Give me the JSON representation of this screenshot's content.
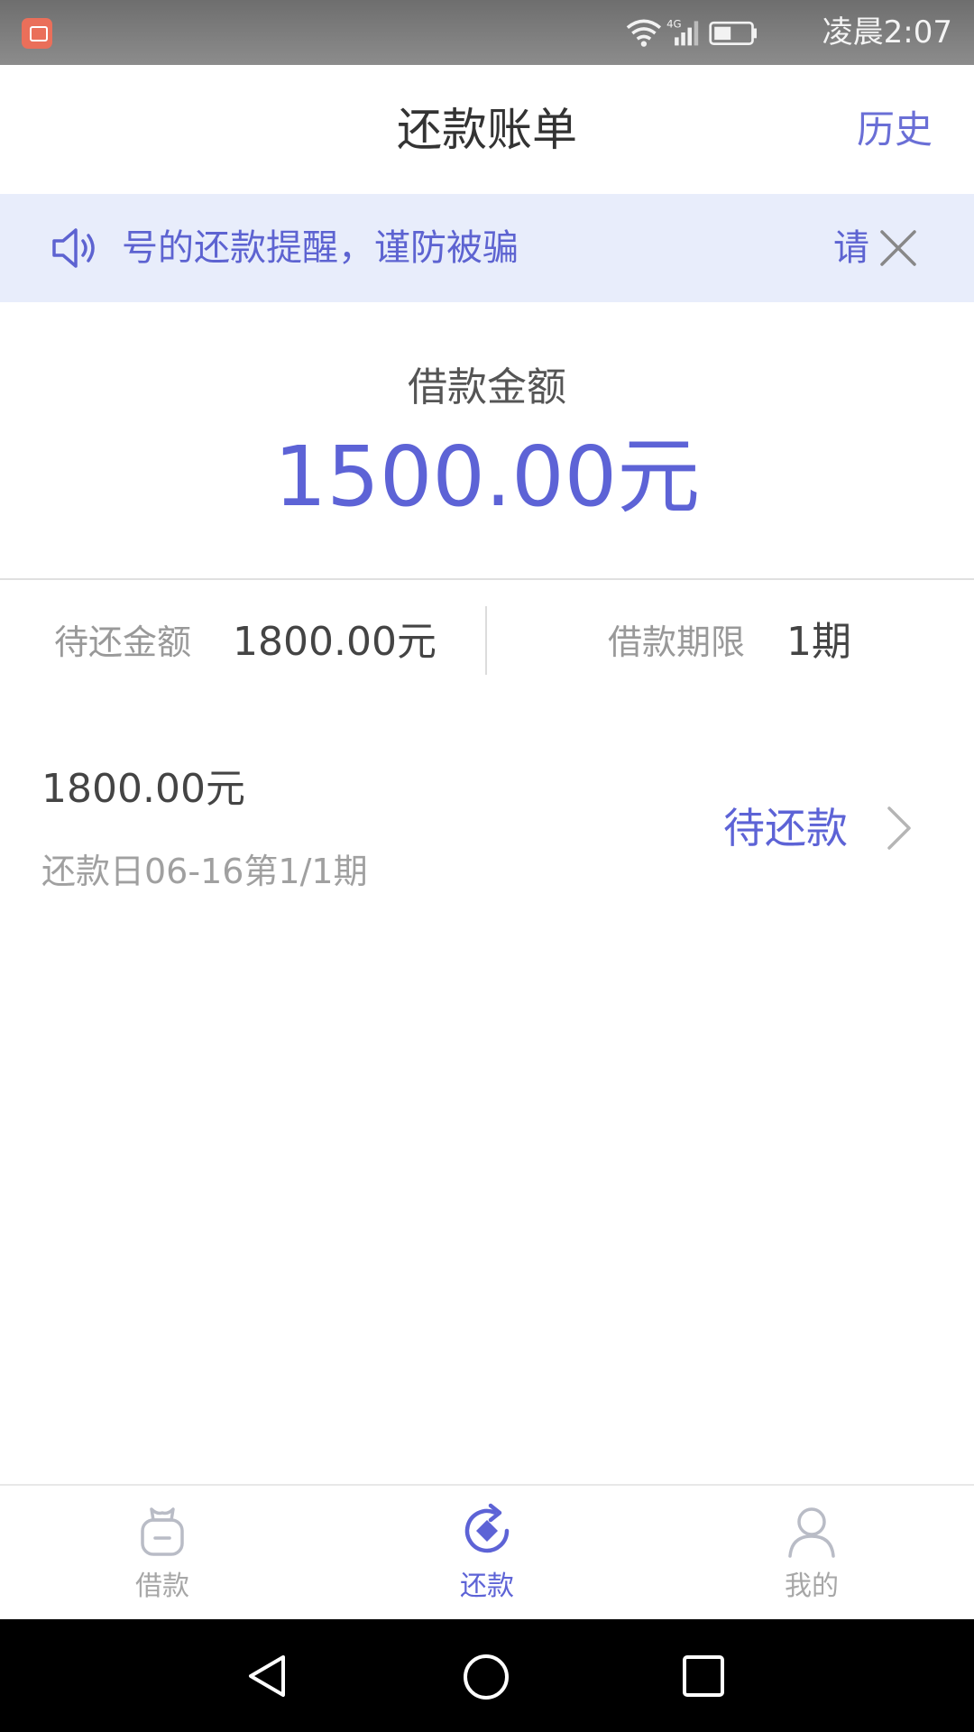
{
  "status_bar": {
    "network": "4G",
    "time": "凌晨2:07"
  },
  "header": {
    "title": "还款账单",
    "history_label": "历史"
  },
  "notice": {
    "text": "号的还款提醒，谨防被骗",
    "tail_text": "请"
  },
  "loan": {
    "amount_label": "借款金额",
    "amount_value": "1500.00元"
  },
  "summary": {
    "pending_label": "待还金额",
    "pending_value": "1800.00元",
    "term_label": "借款期限",
    "term_value": "1期"
  },
  "bill": {
    "amount": "1800.00元",
    "detail": "还款日06-16第1/1期",
    "status": "待还款"
  },
  "tabs": [
    {
      "label": "借款",
      "icon": "bag-icon",
      "active": false
    },
    {
      "label": "还款",
      "icon": "repay-icon",
      "active": true
    },
    {
      "label": "我的",
      "icon": "person-icon",
      "active": false
    }
  ],
  "colors": {
    "accent": "#5d63d6",
    "notice_bg": "#e8edfb",
    "status_bar": "#7a7a7a"
  }
}
